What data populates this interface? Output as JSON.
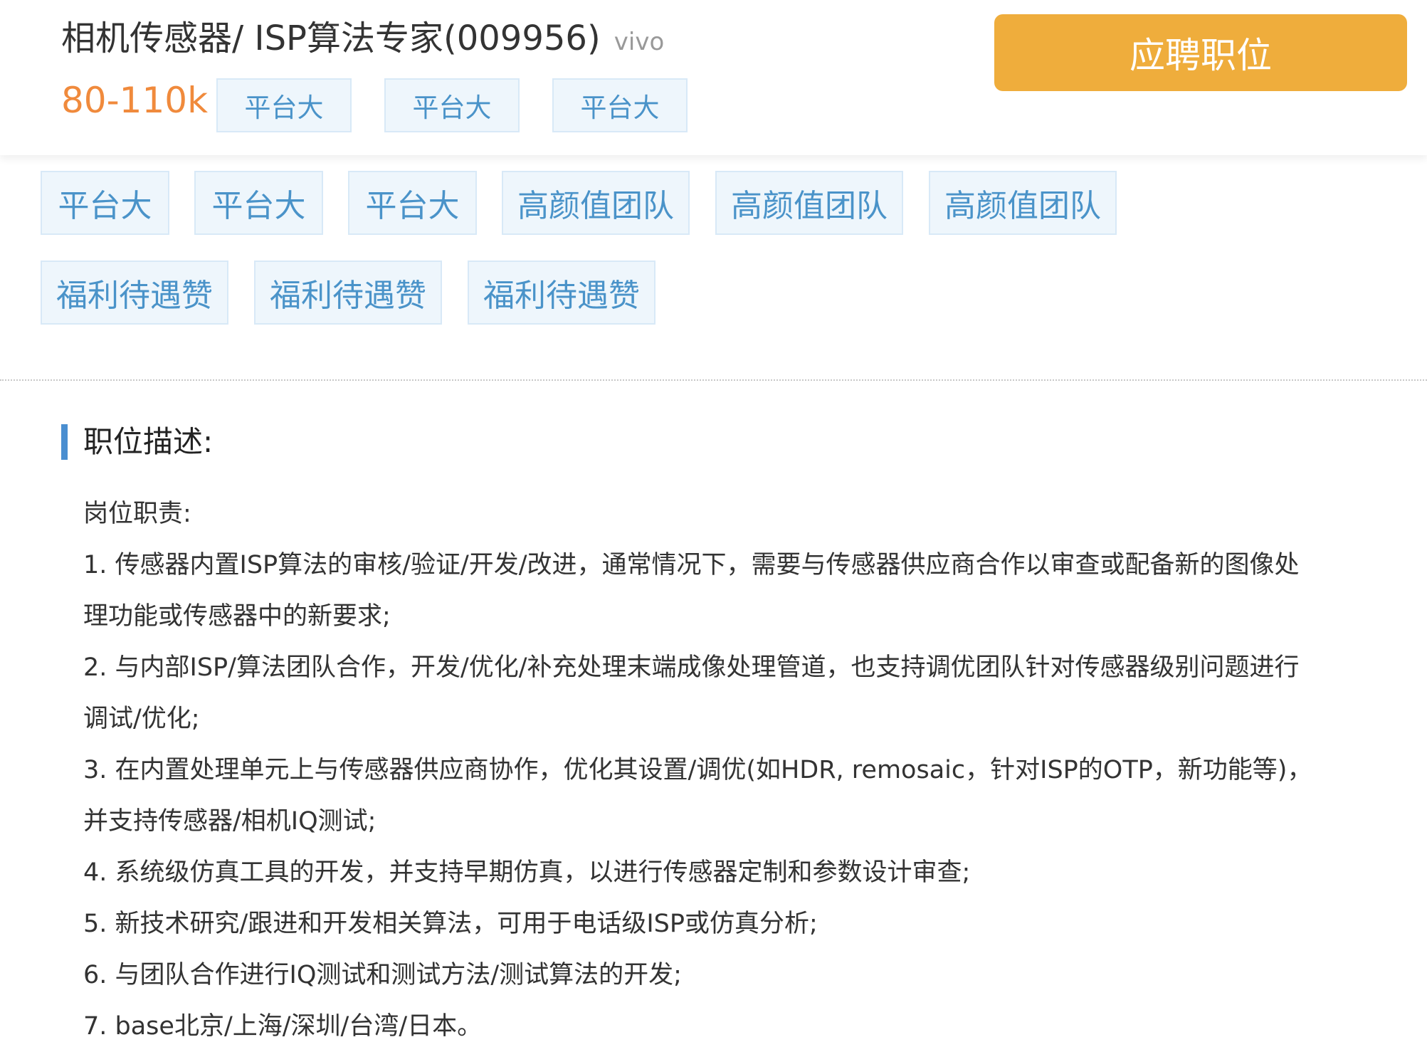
{
  "job": {
    "title": "相机传感器/ ISP算法专家(009956)",
    "company": "vivo",
    "salary": "80-110k",
    "apply_label": "应聘职位"
  },
  "header_tags": [
    "平台大",
    "平台大",
    "平台大"
  ],
  "tags_row1": [
    "平台大",
    "平台大",
    "平台大",
    "高颜值团队",
    "高颜值团队",
    "高颜值团队"
  ],
  "tags_row2": [
    "福利待遇赞",
    "福利待遇赞",
    "福利待遇赞"
  ],
  "description": {
    "heading": "职位描述:",
    "lines": [
      "岗位职责:",
      "1. 传感器内置ISP算法的审核/验证/开发/改进，通常情况下，需要与传感器供应商合作以审查或配备新的图像处",
      "理功能或传感器中的新要求;",
      "2. 与内部ISP/算法团队合作，开发/优化/补充处理末端成像处理管道，也支持调优团队针对传感器级别问题进行",
      "调试/优化;",
      "3. 在内置处理单元上与传感器供应商协作，优化其设置/调优(如HDR, remosaic，针对ISP的OTP，新功能等)，",
      "并支持传感器/相机IQ测试;",
      "4. 系统级仿真工具的开发，并支持早期仿真，以进行传感器定制和参数设计审查;",
      "5. 新技术研究/跟进和开发相关算法，可用于电话级ISP或仿真分析;",
      "6. 与团队合作进行IQ测试和测试方法/测试算法的开发;",
      "7. base北京/上海/深圳/台湾/日本。"
    ]
  }
}
